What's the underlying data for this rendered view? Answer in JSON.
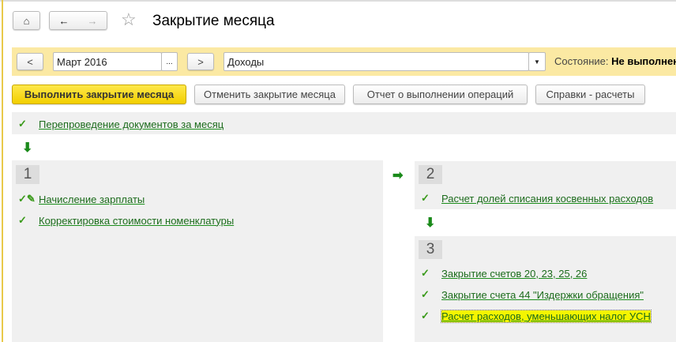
{
  "header": {
    "title": "Закрытие месяца"
  },
  "filters": {
    "prev": "<",
    "period": "Март 2016",
    "period_select": "...",
    "next": ">",
    "tax_mode": "Доходы",
    "state_label": "Состояние:",
    "state_value": "Не выполнено"
  },
  "toolbar": {
    "run": "Выполнить закрытие месяца",
    "cancel": "Отменить закрытие месяца",
    "report": "Отчет о выполнении операций",
    "refs": "Справки - расчеты"
  },
  "steps": {
    "pre": "Перепроведение документов за месяц",
    "g1": {
      "num": "1",
      "items": [
        "Начисление зарплаты",
        "Корректировка стоимости номенклатуры"
      ]
    },
    "g2": {
      "num": "2",
      "items": [
        "Расчет долей списания косвенных расходов"
      ]
    },
    "g3": {
      "num": "3",
      "items": [
        "Закрытие счетов 20, 23, 25, 26",
        "Закрытие счета 44 \"Издержки обращения\"",
        "Расчет расходов, уменьшающих налог УСН"
      ]
    }
  },
  "colors": {
    "accent": "#f5d800",
    "link": "#1c6b1c",
    "band": "#fbe9a3"
  }
}
